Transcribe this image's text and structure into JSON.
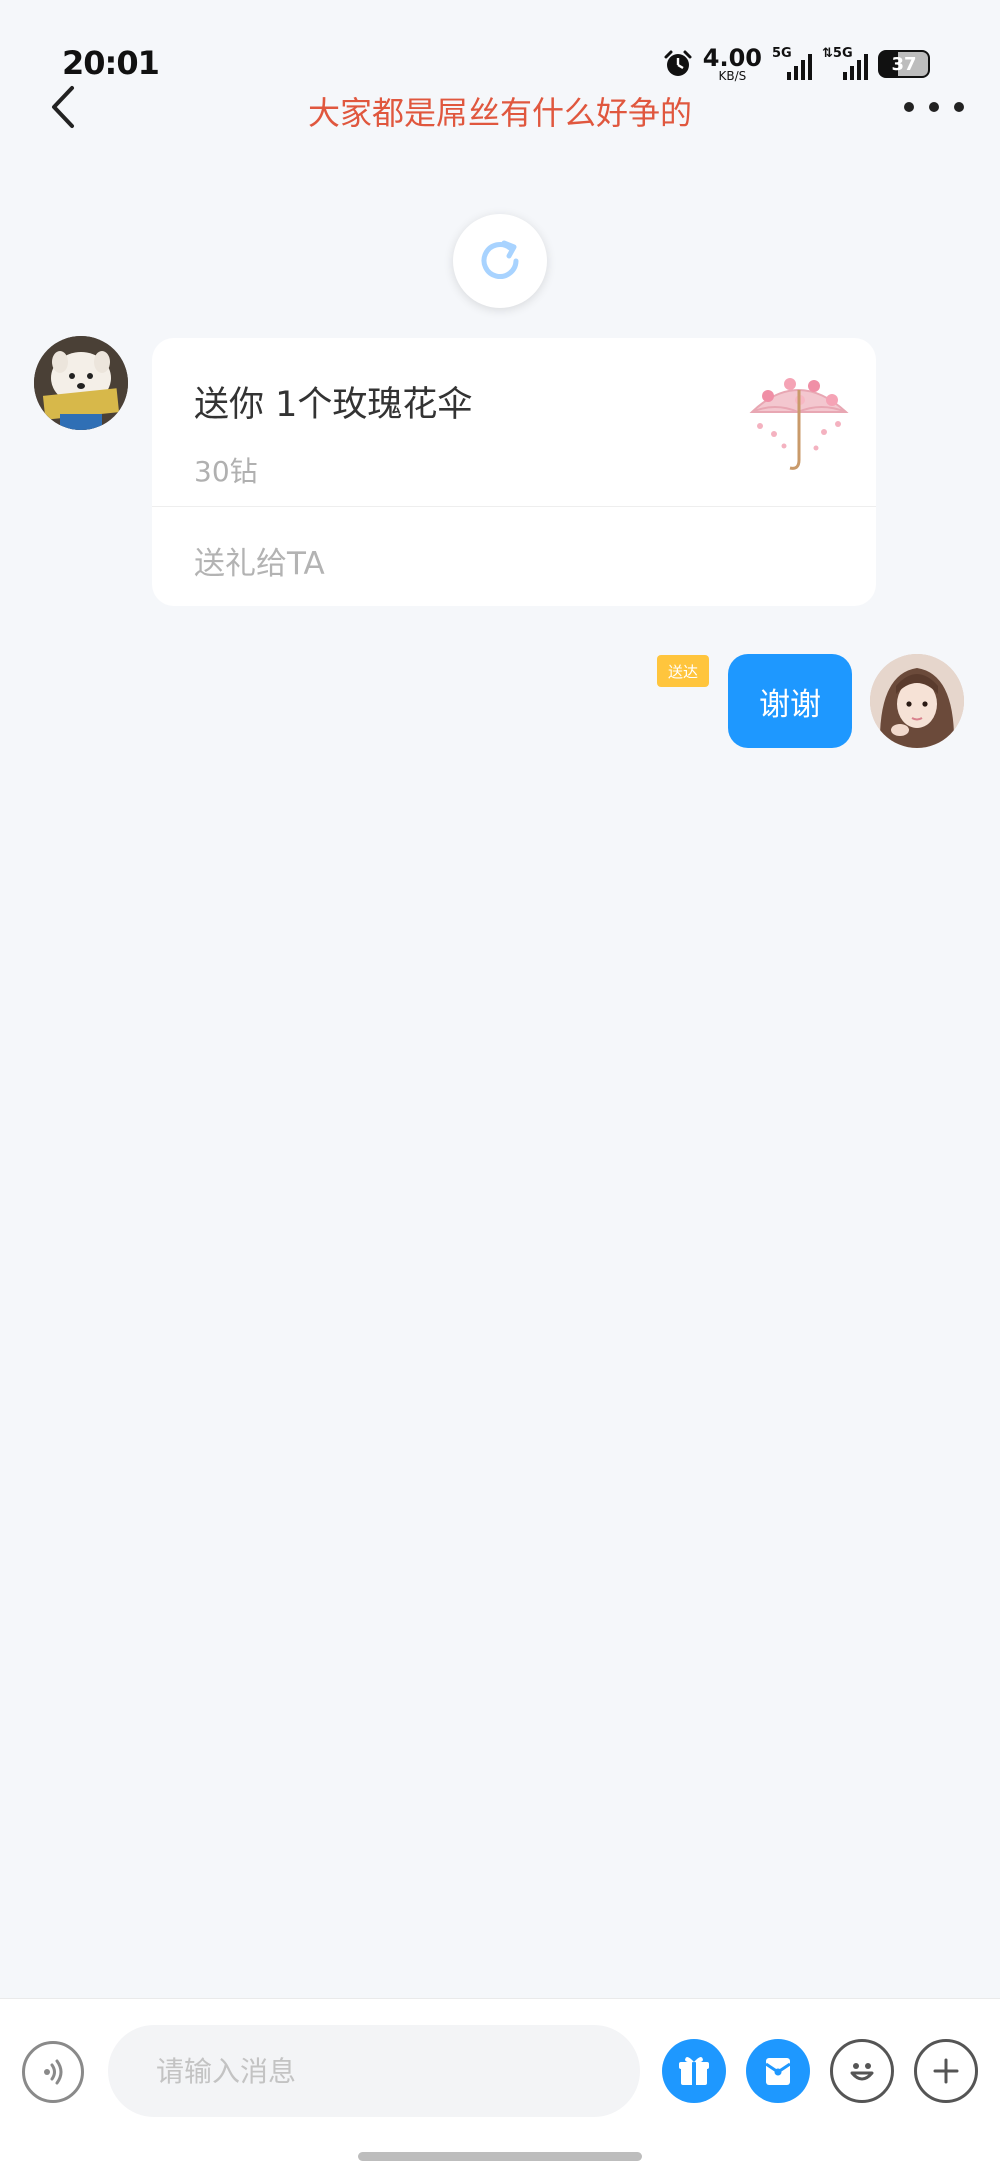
{
  "status_bar": {
    "time": "20:01",
    "net_speed_value": "4.00",
    "net_speed_unit": "KB/S",
    "sim1_label": "5G",
    "sim2_label": "⇅5G",
    "battery": "37"
  },
  "header": {
    "title": "大家都是屌丝有什么好争的",
    "title_color": "#e0573e",
    "back_icon": "chevron-left-icon",
    "more_icon": "more-dots-icon"
  },
  "refresh": {
    "icon": "refresh-icon"
  },
  "messages": [
    {
      "type": "gift",
      "from": "left",
      "gift_text": "送你 1个玫瑰花伞",
      "gift_price": "30钻",
      "gift_action": "送礼给TA",
      "gift_image_icon": "rose-umbrella-icon"
    },
    {
      "type": "text",
      "from": "right",
      "text": "谢谢",
      "status": "送达"
    }
  ],
  "composer": {
    "placeholder": "请输入消息",
    "voice_icon": "voice-icon",
    "gift_icon": "gift-icon",
    "red_packet_icon": "red-packet-icon",
    "emoji_icon": "emoji-icon",
    "plus_icon": "plus-icon"
  },
  "colors": {
    "accent_blue": "#1e98ff",
    "delivered_badge": "#ffc53d",
    "background": "#f5f7fa"
  }
}
